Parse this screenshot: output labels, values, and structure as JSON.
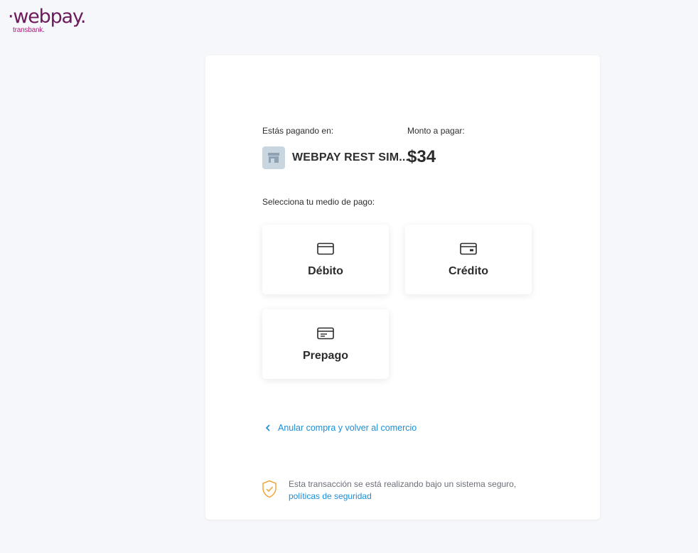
{
  "logo": {
    "word": "·webpay.",
    "sub": "transbank."
  },
  "payment": {
    "paying_at_label": "Estás pagando en:",
    "amount_label": "Monto a pagar:",
    "merchant": "WEBPAY REST SIM...",
    "amount": "$34"
  },
  "methods": {
    "label": "Selecciona tu medio de pago:",
    "items": [
      {
        "label": "Débito",
        "icon": "debit-card-icon"
      },
      {
        "label": "Crédito",
        "icon": "credit-card-icon"
      },
      {
        "label": "Prepago",
        "icon": "prepaid-card-icon"
      }
    ]
  },
  "back_link": "Anular compra y volver al comercio",
  "security": {
    "text": "Esta transacción se está realizando bajo un sistema seguro,",
    "link": "políticas de seguridad"
  },
  "colors": {
    "brand": "#6b1b5c",
    "link": "#1c8dd6",
    "shield": "#f0a73a"
  }
}
